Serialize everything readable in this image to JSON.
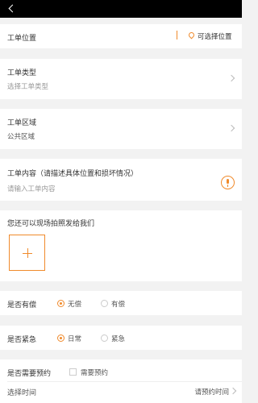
{
  "location": {
    "label": "工单位置",
    "action": "可选择位置"
  },
  "type": {
    "label": "工单类型",
    "value": "选择工单类型"
  },
  "area": {
    "label": "工单区域",
    "value": "公共区域"
  },
  "content": {
    "label": "工单内容（请描述具体位置和损坏情况）",
    "placeholder": "请输入工单内容"
  },
  "photo": {
    "label": "您还可以现场拍照发给我们",
    "add_symbol": "+"
  },
  "paid": {
    "label": "是否有偿",
    "options": [
      "无偿",
      "有偿"
    ],
    "selected": "无偿"
  },
  "urgent": {
    "label": "是否紧急",
    "options": [
      "日常",
      "紧急"
    ],
    "selected": "日常"
  },
  "appointment": {
    "label": "是否需要预约",
    "checkbox_label": "需要预约",
    "time_label": "选择时间",
    "time_placeholder": "请预约时间"
  },
  "colors": {
    "accent": "#f08a2b",
    "topbar": "#000000",
    "background": "#f2f2f2"
  },
  "icons": {
    "back": "chevron-left-icon",
    "location": "map-pin-icon",
    "mic": "microphone-icon",
    "chevron": "chevron-right-icon"
  }
}
